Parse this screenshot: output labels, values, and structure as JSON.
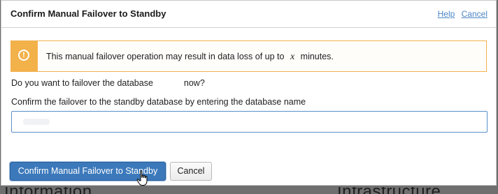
{
  "dialog": {
    "title": "Confirm Manual Failover to Standby",
    "help_link": "Help",
    "cancel_link": "Cancel"
  },
  "warning": {
    "icon": "warning-circle-icon",
    "text_before": "This manual failover operation may result in data loss of up to",
    "variable": "x",
    "text_after": "minutes."
  },
  "question": {
    "text_before": "Do you want to failover the database",
    "text_after": "now?"
  },
  "confirm": {
    "label": "Confirm the failover to the standby database by entering the database name",
    "input_value": ""
  },
  "buttons": {
    "primary_label": "Confirm Manual Failover to Standby",
    "cancel_label": "Cancel"
  },
  "colors": {
    "primary": "#3c79bb",
    "warning": "#f3b14a",
    "link": "#4c86c6"
  }
}
